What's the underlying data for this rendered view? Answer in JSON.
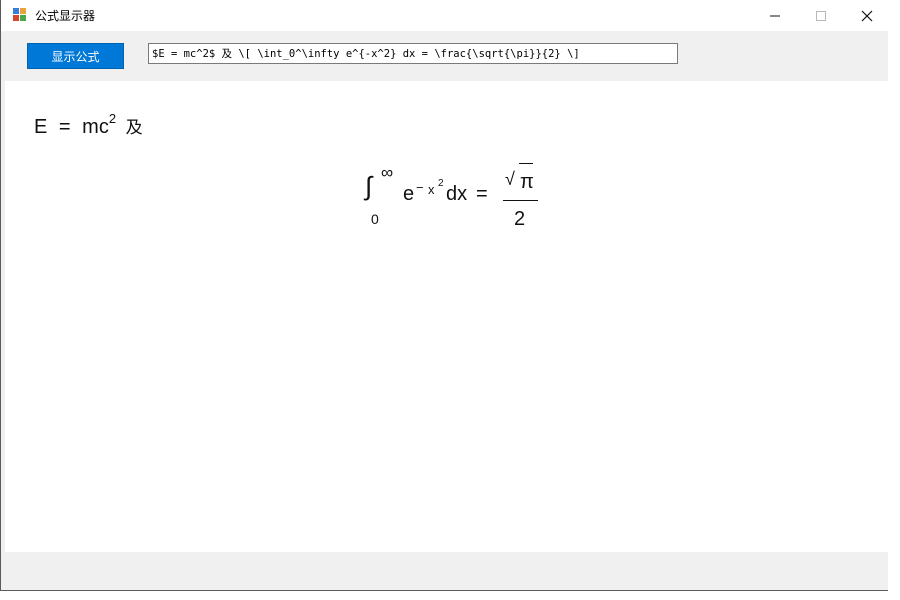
{
  "window": {
    "title": "公式显示器",
    "controls": {
      "minimize": "—",
      "maximize": "☐",
      "close": "✕"
    }
  },
  "toolbar": {
    "show_button_label": "显示公式",
    "formula_value": "$E = mc^2$ 及 \\[ \\int_0^\\infty e^{-x^2} dx = \\frac{\\sqrt{\\pi}}{2} \\]"
  },
  "rendered": {
    "inline": {
      "lhs": "E",
      "eq": "=",
      "base": "mc",
      "exp": "2",
      "conj": "及"
    },
    "display": {
      "integral": "∫",
      "lower": "0",
      "upper": "∞",
      "e": "e",
      "exp_sign": "−",
      "exp_var": "x",
      "exp_pow": "2",
      "dx": "dx",
      "eq": "=",
      "radical": "√",
      "pi": "π",
      "denominator": "2"
    }
  }
}
